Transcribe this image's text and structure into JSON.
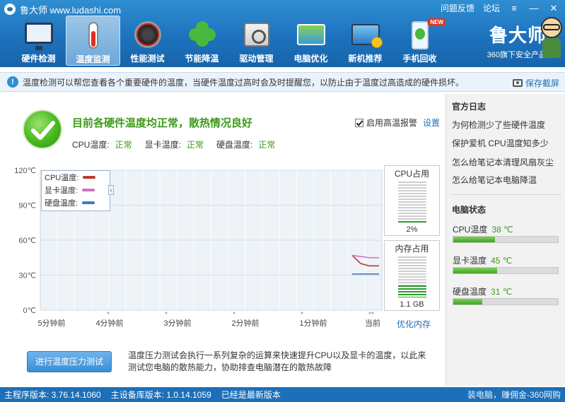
{
  "window": {
    "title": "鲁大师 www.ludashi.com",
    "links": [
      "问题反馈",
      "论坛"
    ]
  },
  "tabs": [
    {
      "label": "硬件检测",
      "icon": "monitor-magnifier-icon"
    },
    {
      "label": "温度监测",
      "icon": "thermometer-icon",
      "active": true
    },
    {
      "label": "性能测试",
      "icon": "speed-gauge-icon"
    },
    {
      "label": "节能降温",
      "icon": "clover-icon"
    },
    {
      "label": "驱动管理",
      "icon": "driver-chip-icon"
    },
    {
      "label": "电脑优化",
      "icon": "pc-optimize-icon"
    },
    {
      "label": "新机推荐",
      "icon": "new-pc-icon"
    },
    {
      "label": "手机回收",
      "icon": "phone-recycle-icon",
      "badge": "NEW"
    }
  ],
  "brand": {
    "name": "鲁大师",
    "sub": "360旗下安全产品"
  },
  "infobar": {
    "text": "温度检测可以帮您查看各个重要硬件的温度，当硬件温度过高时会及时提醒您，以防止由于温度过高造成的硬件损坏。",
    "save_screenshot": "保存截屏"
  },
  "status": {
    "headline": "目前各硬件温度均正常，散热情况良好",
    "cpu_label": "CPU温度:",
    "cpu_value": "正常",
    "gpu_label": "显卡温度:",
    "gpu_value": "正常",
    "disk_label": "硬盘温度:",
    "disk_value": "正常",
    "alarm_label": "启用高温报警",
    "settings": "设置"
  },
  "chart_data": {
    "type": "line",
    "y_ticks": [
      "120℃",
      "90℃",
      "60℃",
      "30℃",
      "0℃"
    ],
    "ylim": [
      0,
      120
    ],
    "x_ticks": [
      "5分钟前",
      "4分钟前",
      "3分钟前",
      "2分钟前",
      "1分钟前",
      "当前"
    ],
    "series": [
      {
        "name": "CPU温度:",
        "color": "#c0392b",
        "values": [
          47,
          40,
          38,
          38
        ]
      },
      {
        "name": "显卡温度:",
        "color": "#d070c8",
        "values": [
          47,
          46,
          45,
          45
        ]
      },
      {
        "name": "硬盘温度:",
        "color": "#3a7fc0",
        "values": [
          31,
          31,
          31,
          31
        ]
      }
    ]
  },
  "meters": {
    "cpu_title": "CPU占用",
    "cpu_value": "2%",
    "cpu_fraction": 0.02,
    "mem_title": "内存占用",
    "mem_value": "1.1 GB",
    "mem_fraction": 0.28,
    "optimize_mem": "优化内存"
  },
  "stress": {
    "button": "进行温度压力测试",
    "description": "温度压力测试会执行一系列复杂的运算来快速提升CPU以及显卡的温度，以此来测试您电脑的散热能力，协助排查电脑潜在的散热故障"
  },
  "sidebar": {
    "log_title": "官方日志",
    "log_links": [
      "为何检测少了些硬件温度",
      "保护爱机 CPU温度知多少",
      "怎么给笔记本清理风扇灰尘",
      "怎么给笔记本电脑降温"
    ],
    "pc_status_title": "电脑状态",
    "hw": [
      {
        "label": "CPU温度",
        "value": "38 ℃",
        "fraction": 0.4
      },
      {
        "label": "显卡温度",
        "value": "45 ℃",
        "fraction": 0.42
      },
      {
        "label": "硬盘温度",
        "value": "31 ℃",
        "fraction": 0.28
      }
    ]
  },
  "statusbar": {
    "main_version": "主程序版本: 3.76.14.1060",
    "db_version": "主设备库版本: 1.0.14.1059",
    "latest": "已经是最新版本",
    "watermark": "装电脑，赚佣金-360网购"
  }
}
